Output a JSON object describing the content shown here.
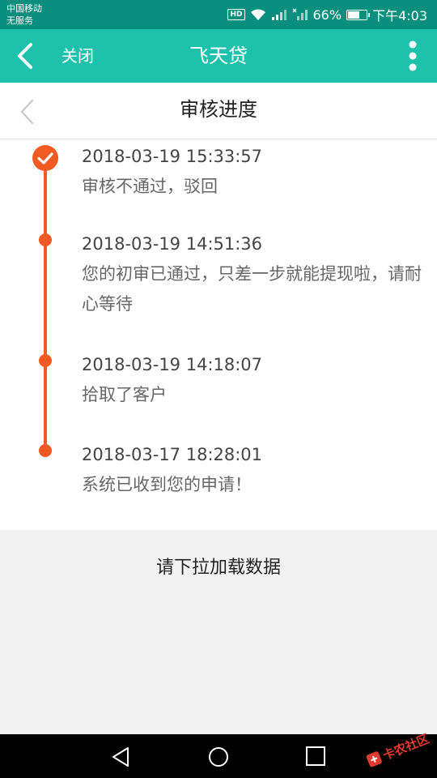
{
  "status_bar": {
    "carrier": "中国移动",
    "service": "无服务",
    "hd": "HD",
    "battery_percent": "66%",
    "battery_level": 0.66,
    "time": "下午4:03"
  },
  "app_bar": {
    "close_label": "关闭",
    "title": "飞天贷"
  },
  "sub_header": {
    "title": "审核进度"
  },
  "timeline": [
    {
      "time": "2018-03-19 15:33:57",
      "message": "审核不通过，驳回"
    },
    {
      "time": "2018-03-19 14:51:36",
      "message": "您的初审已通过，只差一步就能提现啦，请耐心等待"
    },
    {
      "time": "2018-03-19 14:18:07",
      "message": "拾取了客户"
    },
    {
      "time": "2018-03-17 18:28:01",
      "message": "系统已收到您的申请！"
    }
  ],
  "pull_to_load": "请下拉加载数据",
  "watermark": "卡农社区",
  "colors": {
    "status_bar": "#0a8f7e",
    "app_bar": "#1ec1ab",
    "accent": "#f15a22"
  }
}
